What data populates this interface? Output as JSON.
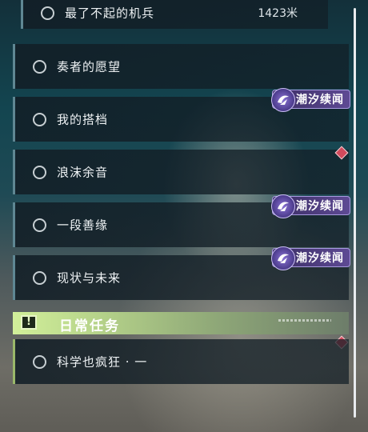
{
  "quests": [
    {
      "label": "最了不起的机兵",
      "distance": "1423米"
    },
    {
      "label": "奏者的愿望"
    },
    {
      "label": "我的搭档"
    },
    {
      "label": "浪沫余音"
    },
    {
      "label": "一段善缘"
    },
    {
      "label": "现状与未来"
    }
  ],
  "tag": {
    "label": "潮汐续闻",
    "icon": "tidal-emblem-icon",
    "color": "#5e4a94"
  },
  "marker": {
    "icon": "diamond-marker-icon",
    "color": "#d24a5c"
  },
  "daily": {
    "title": "日常任务",
    "icon": "alert-icon",
    "accent": "#b6d38a",
    "quests": [
      {
        "label": "科学也疯狂 · 一"
      }
    ]
  }
}
